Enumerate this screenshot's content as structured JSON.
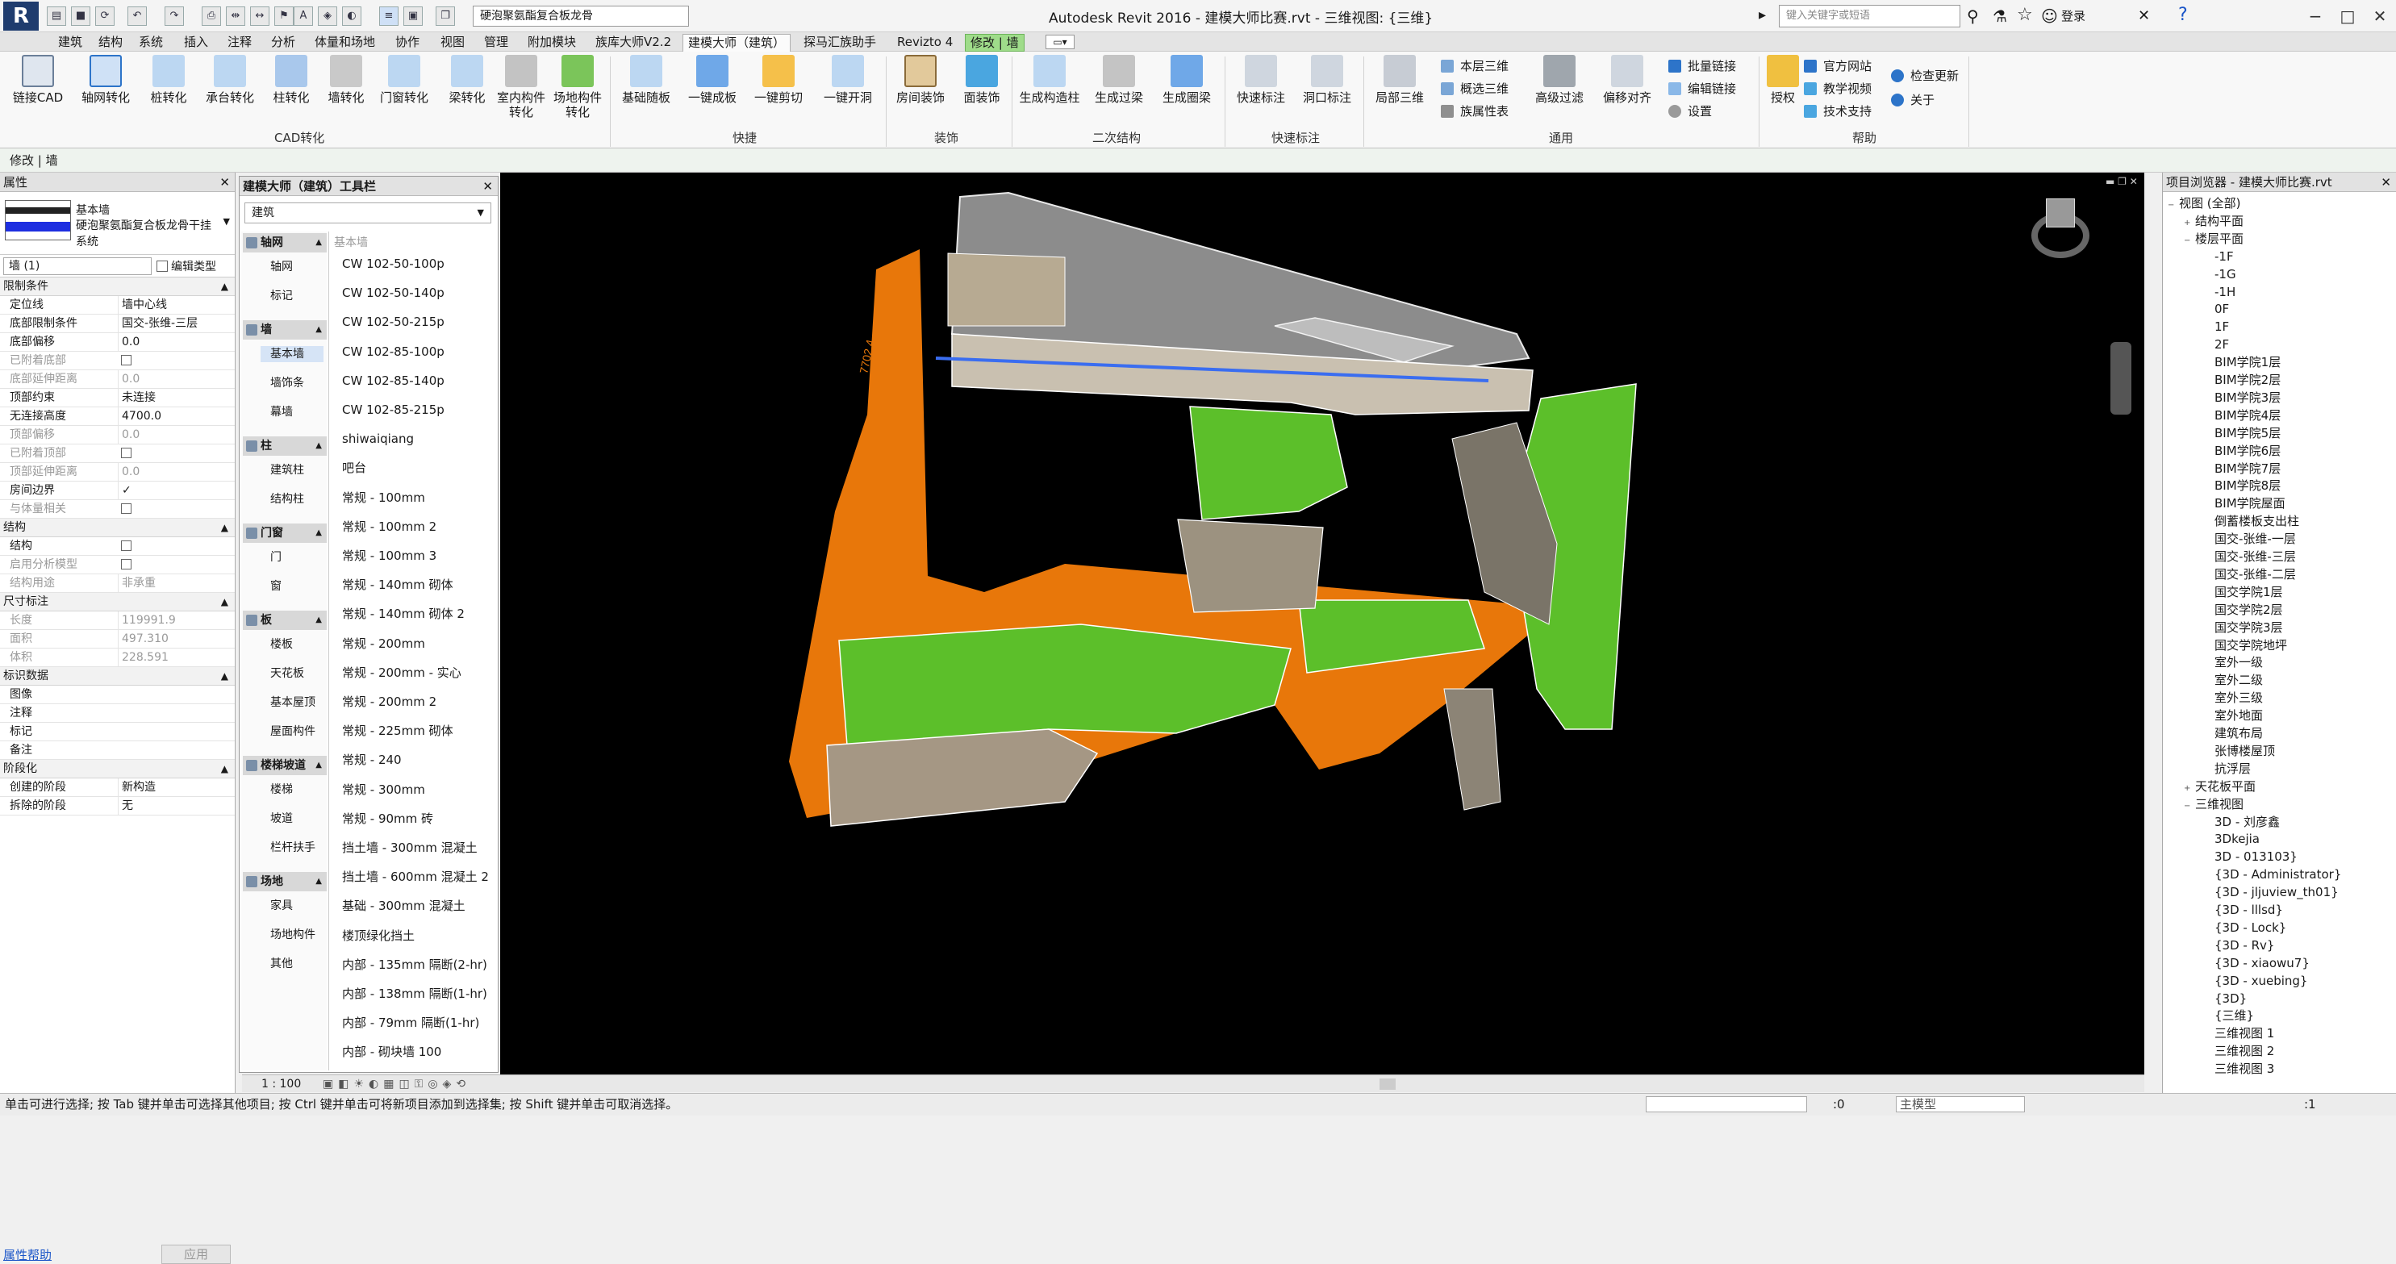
{
  "app": {
    "title": "Autodesk Revit 2016 -    建模大师比赛.rvt - 三维视图: {三维}",
    "type_selector": "硬泡聚氨酯复合板龙骨",
    "search_placeholder": "键入关键字或短语",
    "login": "登录"
  },
  "tabs": [
    "建筑",
    "结构",
    "系统",
    "插入",
    "注释",
    "分析",
    "体量和场地",
    "协作",
    "视图",
    "管理",
    "附加模块",
    "族库大师V2.2",
    "建模大师（建筑）",
    "探马汇族助手",
    "Revizto 4",
    "修改 | 墙"
  ],
  "ribbon": {
    "panels": [
      "CAD转化",
      "快捷",
      "装饰",
      "二次结构",
      "快速标注",
      "通用",
      "帮助"
    ],
    "cad": [
      "链接CAD",
      "轴网转化",
      "桩转化",
      "承台转化",
      "柱转化",
      "墙转化",
      "门窗转化",
      "梁转化",
      "室内构件转化",
      "场地构件转化"
    ],
    "quick": [
      "基础随板",
      "一键成板",
      "一键剪切",
      "一键开洞"
    ],
    "decor": [
      "房间装饰",
      "面装饰"
    ],
    "secondary": [
      "生成构造柱",
      "生成过梁",
      "生成圈梁"
    ],
    "annot": [
      "快速标注",
      "洞口标注"
    ],
    "general_big": [
      "局部三维",
      "高级过滤",
      "偏移对齐"
    ],
    "general_small": [
      "本层三维",
      "概选三维",
      "族属性表",
      "批量链接",
      "编辑链接",
      "设置"
    ],
    "help_big": "授权",
    "help_small": [
      "官方网站",
      "教学视频",
      "技术支持",
      "检查更新",
      "关于"
    ]
  },
  "context_label": "修改 | 墙",
  "properties": {
    "header": "属性",
    "type_family": "基本墙",
    "type_name": "硬泡聚氨酯复合板龙骨干挂系统",
    "instance_count": "墙 (1)",
    "edit_type": "编辑类型",
    "groups": [
      {
        "name": "限制条件",
        "rows": [
          [
            "定位线",
            "墙中心线",
            false
          ],
          [
            "底部限制条件",
            "国交-张维-三层",
            false
          ],
          [
            "底部偏移",
            "0.0",
            false
          ],
          [
            "已附着底部",
            "",
            true
          ],
          [
            "底部延伸距离",
            "0.0",
            true
          ],
          [
            "顶部约束",
            "未连接",
            false
          ],
          [
            "无连接高度",
            "4700.0",
            false
          ],
          [
            "顶部偏移",
            "0.0",
            true
          ],
          [
            "已附着顶部",
            "",
            true
          ],
          [
            "顶部延伸距离",
            "0.0",
            true
          ],
          [
            "房间边界",
            "✓",
            false
          ],
          [
            "与体量相关",
            "",
            true
          ]
        ]
      },
      {
        "name": "结构",
        "rows": [
          [
            "结构",
            "",
            false
          ],
          [
            "启用分析模型",
            "",
            true
          ],
          [
            "结构用途",
            "非承重",
            true
          ]
        ]
      },
      {
        "name": "尺寸标注",
        "rows": [
          [
            "长度",
            "119991.9",
            true
          ],
          [
            "面积",
            "497.310",
            true
          ],
          [
            "体积",
            "228.591",
            true
          ]
        ]
      },
      {
        "name": "标识数据",
        "rows": [
          [
            "图像",
            "",
            false
          ],
          [
            "注释",
            "",
            false
          ],
          [
            "标记",
            "",
            false
          ],
          [
            "备注",
            "",
            false
          ]
        ]
      },
      {
        "name": "阶段化",
        "rows": [
          [
            "创建的阶段",
            "新构造",
            false
          ],
          [
            "拆除的阶段",
            "无",
            false
          ]
        ]
      }
    ],
    "help_link": "属性帮助",
    "apply": "应用"
  },
  "toolbar_panel": {
    "title": "建模大师（建筑）工具栏",
    "dropdown": "建筑",
    "categories": [
      {
        "name": "轴网",
        "items": [
          "轴网",
          "标记"
        ]
      },
      {
        "name": "墙",
        "items": [
          "基本墙",
          "墙饰条",
          "幕墙"
        ]
      },
      {
        "name": "柱",
        "items": [
          "建筑柱",
          "结构柱"
        ]
      },
      {
        "name": "门窗",
        "items": [
          "门",
          "窗"
        ]
      },
      {
        "name": "板",
        "items": [
          "楼板",
          "天花板",
          "基本屋顶",
          "屋面构件"
        ]
      },
      {
        "name": "楼梯坡道",
        "items": [
          "楼梯",
          "坡道",
          "栏杆扶手"
        ]
      },
      {
        "name": "场地",
        "items": [
          "家具",
          "场地构件",
          "其他"
        ]
      }
    ],
    "list_header": "基本墙",
    "list": [
      "CW 102-50-100p",
      "CW 102-50-140p",
      "CW 102-50-215p",
      "CW 102-85-100p",
      "CW 102-85-140p",
      "CW 102-85-215p",
      "shiwaiqiang",
      "吧台",
      "常规 - 100mm",
      "常规 - 100mm 2",
      "常规 - 100mm 3",
      "常规 - 140mm 砌体",
      "常规 - 140mm 砌体 2",
      "常规 - 200mm",
      "常规 - 200mm - 实心",
      "常规 - 200mm 2",
      "常规 - 225mm 砌体",
      "常规 - 240",
      "常规 - 300mm",
      "常规 - 90mm 砖",
      "挡土墙 - 300mm 混凝土",
      "挡土墙 - 600mm 混凝土 2",
      "基础 - 300mm 混凝土",
      "楼顶绿化挡土",
      "内部 - 135mm 隔断(2-hr)",
      "内部 - 138mm 隔断(1-hr)",
      "内部 - 79mm 隔断(1-hr)",
      "内部 - 砌块墙 100"
    ]
  },
  "viewport": {
    "dimension_label": "7702.4",
    "view_scale": "1 : 100"
  },
  "browser": {
    "title": "项目浏览器 - 建模大师比赛.rvt",
    "root": "视图 (全部)",
    "structural_plans": "结构平面",
    "floor_plans_label": "楼层平面",
    "floor_plans": [
      "-1F",
      "-1G",
      "-1H",
      "0F",
      "1F",
      "2F",
      "BIM学院1层",
      "BIM学院2层",
      "BIM学院3层",
      "BIM学院4层",
      "BIM学院5层",
      "BIM学院6层",
      "BIM学院7层",
      "BIM学院8层",
      "BIM学院屋面",
      "倒蓄楼板支出柱",
      "国交-张维-一层",
      "国交-张维-三层",
      "国交-张维-二层",
      "国交学院1层",
      "国交学院2层",
      "国交学院3层",
      "国交学院地坪",
      "室外一级",
      "室外二级",
      "室外三级",
      "室外地面",
      "建筑布局",
      "张博楼屋顶",
      "抗浮层"
    ],
    "ceiling_plans": "天花板平面",
    "views3d_label": "三维视图",
    "views3d": [
      "3D - 刘彦鑫",
      "3Dkejia",
      "3D - 013103}",
      "{3D - Administrator}",
      "{3D - jljuview_th01}",
      "{3D - lllsd}",
      "{3D - Lock}",
      "{3D - Rv}",
      "{3D - xiaowu7}",
      "{3D - xuebing}",
      "{3D}",
      "{三维}",
      "三维视图 1",
      "三维视图 2",
      "三维视图 3"
    ]
  },
  "status": {
    "text": "单击可进行选择; 按 Tab 键并单击可选择其他项目; 按 Ctrl 键并单击可将新项目添加到选择集; 按 Shift 键并单击可取消选择。",
    "count": ":0",
    "model": "主模型",
    "filter": ":1"
  },
  "colors": {
    "orange": "#e8770a",
    "green": "#5cbf2a",
    "accent": "#d6e4f6",
    "modify_tab": "#9fdc8a"
  }
}
